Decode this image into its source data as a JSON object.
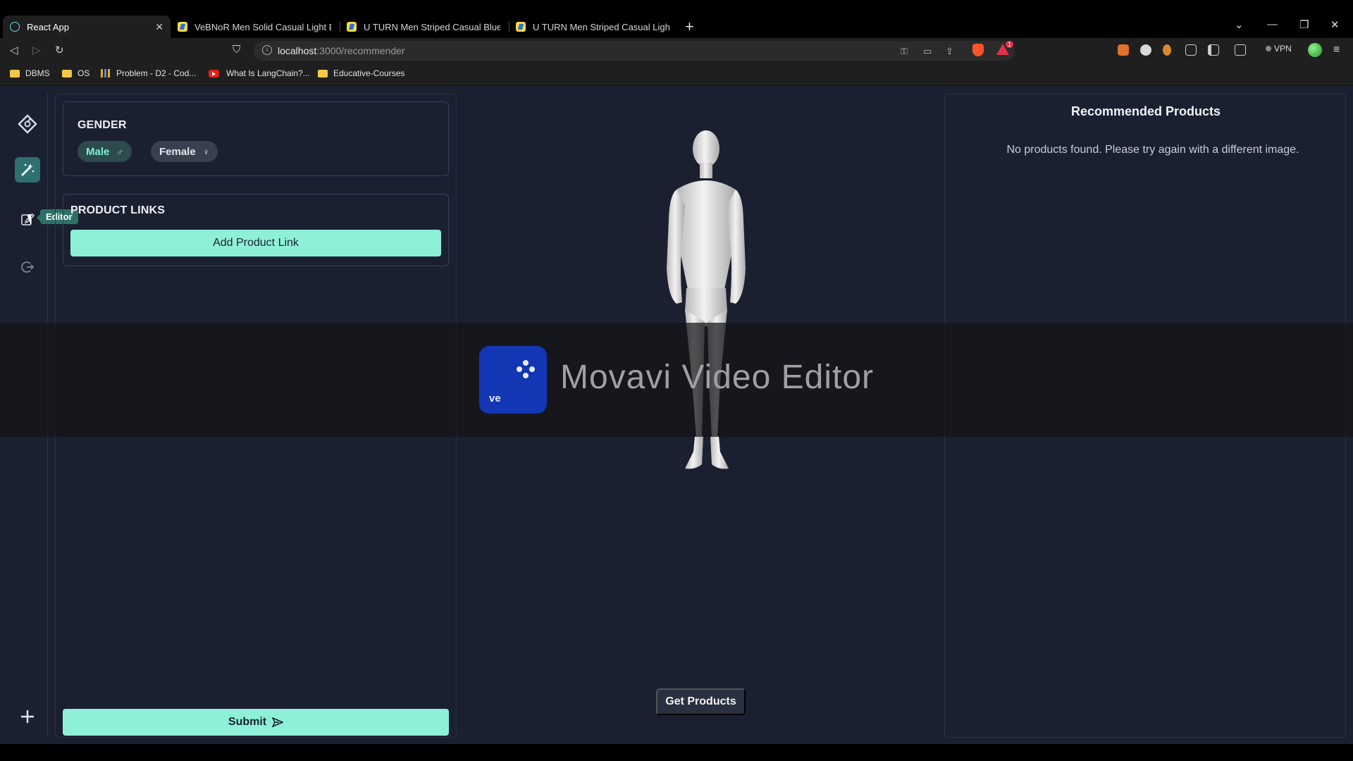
{
  "browser": {
    "tabs": [
      {
        "title": "React App",
        "active": true
      },
      {
        "title": "VeBNoR Men Solid Casual Light Blue Sh"
      },
      {
        "title": "U TURN Men Striped Casual Blue Shirt"
      },
      {
        "title": "U TURN Men Striped Casual Light Gre"
      }
    ],
    "url_host": "localhost",
    "url_path": ":3000/recommender",
    "rewards_badge": "1",
    "vpn_label": "VPN",
    "bookmarks": [
      "DBMS",
      "OS",
      "Problem - D2 - Cod...",
      "What Is LangChain?...",
      "Educative-Courses"
    ]
  },
  "sidebar": {
    "items": [
      "logo-diamond-icon",
      "magic-wand-icon",
      "edit-icon",
      "logout-icon"
    ],
    "tooltip": "Editor",
    "add_icon": "plus-icon"
  },
  "gender": {
    "title": "GENDER",
    "options": [
      {
        "label": "Male",
        "selected": true
      },
      {
        "label": "Female",
        "selected": false
      }
    ]
  },
  "product_links": {
    "title": "PRODUCT LINKS",
    "add_label": "Add Product Link"
  },
  "submit_label": "Submit",
  "get_products_label": "Get Products",
  "recommended": {
    "title": "Recommended Products",
    "empty_message": "No products found. Please try again with a different image."
  },
  "watermark": {
    "logo_text": "ve",
    "text": "Movavi Video Editor"
  },
  "colors": {
    "accent": "#8ef0d8",
    "app_bg": "#1b2031",
    "active_rail": "#2f6f70"
  }
}
